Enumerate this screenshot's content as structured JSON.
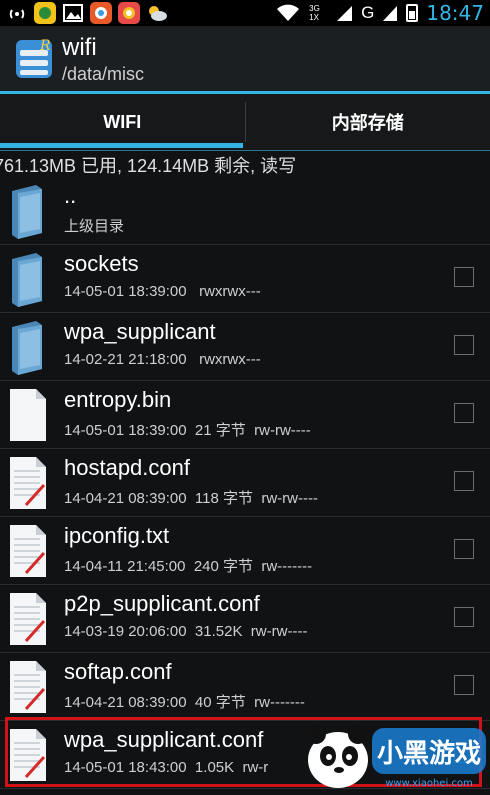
{
  "status_bar": {
    "time": "18:47",
    "network_label": "G",
    "signal_label": "3G 1X",
    "left_icons": [
      "wifi-tether-icon",
      "app-icon-1",
      "image-icon",
      "browser-icon",
      "chrome-icon",
      "weather-icon"
    ]
  },
  "action_bar": {
    "title": "wifi",
    "subtitle": "/data/misc"
  },
  "tabs": [
    {
      "label": "WIFI",
      "active": true
    },
    {
      "label": "内部存储",
      "active": false
    }
  ],
  "storage_info": "761.13MB 已用, 124.14MB 剩余, 读写",
  "files": [
    {
      "name": "..",
      "meta": "上级目录",
      "type": "folder",
      "has_checkbox": false
    },
    {
      "name": "sockets",
      "meta": "14-05-01 18:39:00   rwxrwx---",
      "type": "folder",
      "has_checkbox": true
    },
    {
      "name": "wpa_supplicant",
      "meta": "14-02-21 21:18:00   rwxrwx---",
      "type": "folder",
      "has_checkbox": true
    },
    {
      "name": "entropy.bin",
      "meta": "14-05-01 18:39:00  21 字节  rw-rw----",
      "type": "binary",
      "has_checkbox": true
    },
    {
      "name": "hostapd.conf",
      "meta": "14-04-21 08:39:00  118 字节  rw-rw----",
      "type": "text",
      "has_checkbox": true
    },
    {
      "name": "ipconfig.txt",
      "meta": "14-04-11 21:45:00  240 字节  rw-------",
      "type": "text",
      "has_checkbox": true
    },
    {
      "name": "p2p_supplicant.conf",
      "meta": "14-03-19 20:06:00  31.52K  rw-rw----",
      "type": "text",
      "has_checkbox": true
    },
    {
      "name": "softap.conf",
      "meta": "14-04-21 08:39:00  40 字节  rw-------",
      "type": "text",
      "has_checkbox": true
    },
    {
      "name": "wpa_supplicant.conf",
      "meta": "14-05-01 18:43:00  1.05K  rw-r",
      "type": "text",
      "has_checkbox": true
    }
  ],
  "watermark": {
    "brand": "小黑游戏",
    "url": "www.xiaohei.com"
  },
  "colors": {
    "accent": "#33b5e5",
    "highlight": "#d0121b"
  }
}
